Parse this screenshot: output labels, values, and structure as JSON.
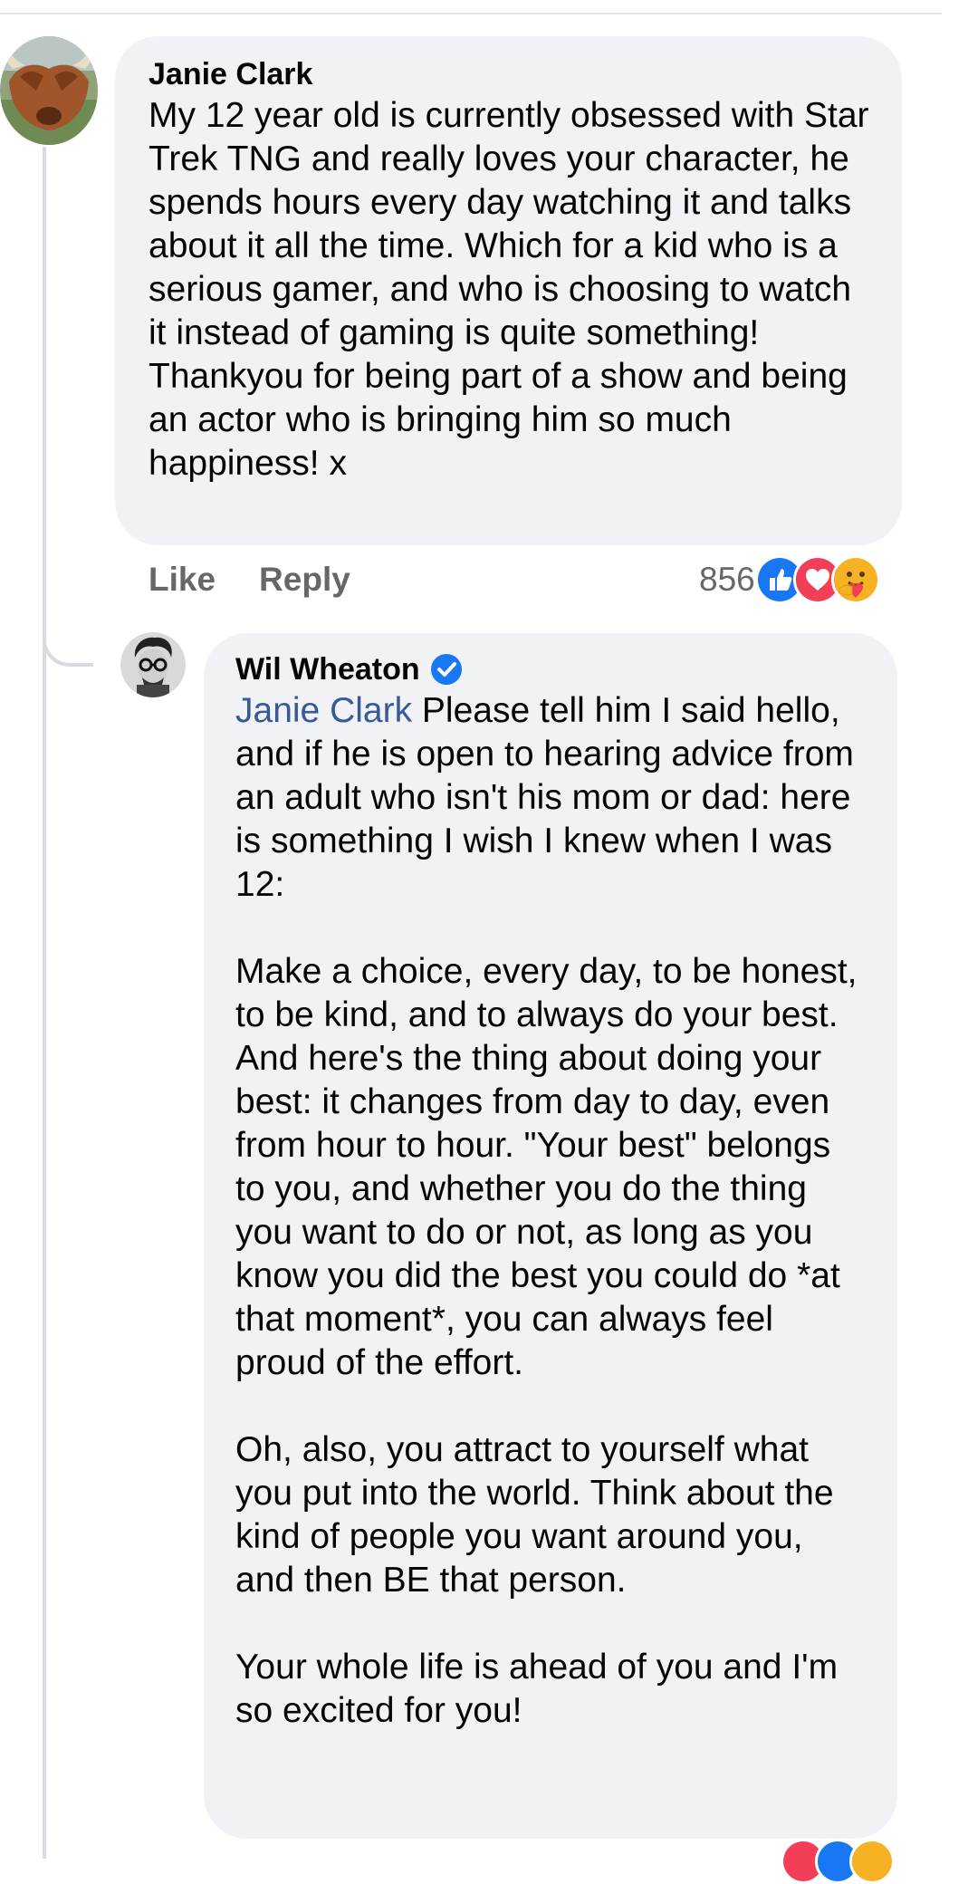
{
  "comment": {
    "author": "Janie Clark",
    "text": "My 12 year old is currently obsessed with Star Trek TNG and really loves your character, he spends hours every day watching it and talks about it all the time. Which for a kid who is a serious gamer, and who is choosing to watch it instead of gaming is quite something! Thankyou for being part of a show and being an actor who is bringing him so much happiness! x",
    "actions": {
      "like": "Like",
      "reply": "Reply"
    },
    "reaction_count": "856",
    "reaction_icons": [
      "like-icon",
      "love-icon",
      "care-icon"
    ]
  },
  "reply": {
    "author": "Wil Wheaton",
    "verified_icon": "verified-badge-icon",
    "mention": "Janie Clark",
    "text": " Please tell him I said hello, and if he is open to hearing advice from an adult who isn't his mom or dad: here is something I wish I knew when I was 12:\n\nMake a choice, every day, to be honest, to be kind, and to always do your best. And here's the thing about doing your best: it changes from day to day, even from hour to hour. \"Your best\" belongs to you, and whether you do the thing you want to do or not, as long as you know you did the best you could do *at that moment*, you can always feel proud of the effort.\n\nOh, also, you attract to yourself what you put into the world. Think about the kind of people you want around you, and then BE that person.\n\nYour whole life is ahead of you and I'm so excited for you!"
  },
  "colors": {
    "bubble": "#f0f2f5",
    "mention": "#385898",
    "muted": "#65676b",
    "like": "#1877f2",
    "love": "#f33e58",
    "care": "#f7b125"
  }
}
